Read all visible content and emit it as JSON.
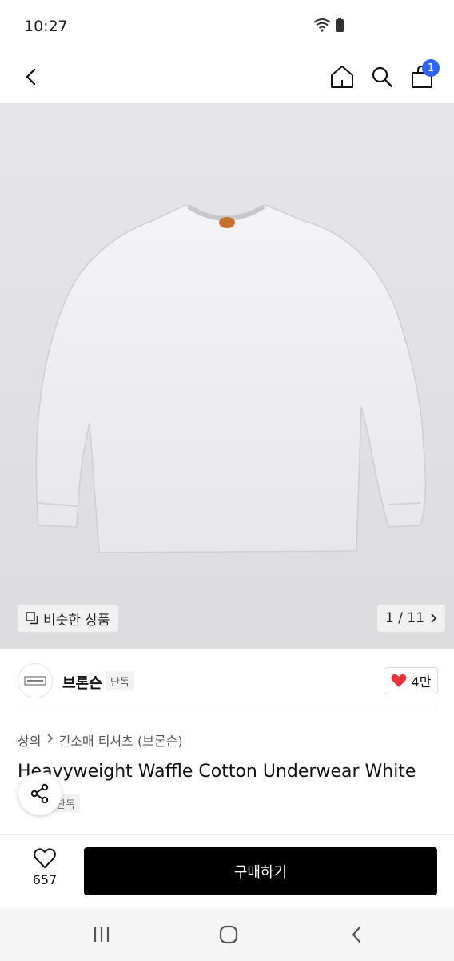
{
  "status_bar": {
    "time": "10:27"
  },
  "header": {
    "cart_count": "1"
  },
  "image": {
    "similar_label": "비슷한 상품",
    "pager": "1 / 11"
  },
  "brand": {
    "name": "브론슨",
    "tag": "단독",
    "likes": "4만"
  },
  "product": {
    "breadcrumb": [
      "상의",
      "긴소매 티셔츠 (브론슨)"
    ],
    "title": "Heavyweight Waffle Cotton Underwear White",
    "sub_tag": "단독"
  },
  "bottom": {
    "wish_count": "657",
    "buy_label": "구매하기"
  },
  "colors": {
    "accent": "#2f63f0",
    "heart": "#e8333a",
    "buy_button": "#000000"
  }
}
